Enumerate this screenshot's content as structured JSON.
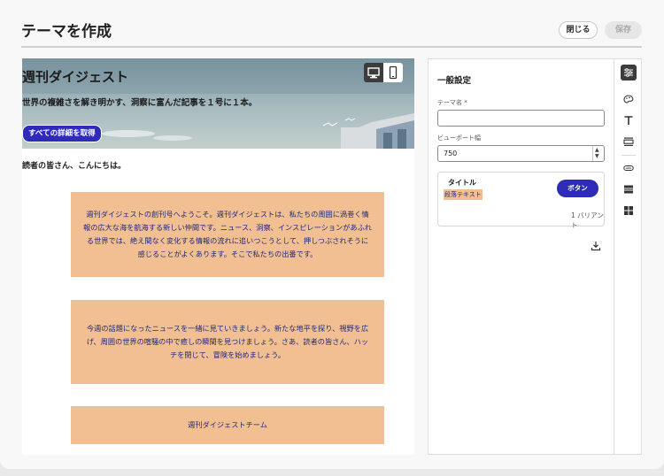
{
  "header": {
    "title": "テーマを作成",
    "close_label": "閉じる",
    "save_label": "保存"
  },
  "preview": {
    "device_icons": [
      "desktop-icon",
      "mobile-icon"
    ],
    "hero": {
      "title": "週刊ダイジェスト",
      "subtitle": "世界の複雑さを解き明かす、洞察に富んだ記事を１号に１本。",
      "button_label": "すべての詳細を取得"
    },
    "greeting": "読者の皆さん、こんにちは。",
    "blocks": [
      {
        "text": "週刊ダイジェストの創刊号へようこそ。週刊ダイジェストは、私たちの周囲に渦巻く情報の広大な海を航海する新しい仲間です。ニュース、洞察、インスピレーションがあふれる世界では、絶え間なく変化する情報の流れに追いつこうとして、押しつぶされそうに感じることがよくあります。そこで私たちの出番です。"
      },
      {
        "text": "今週の話題になったニュースを一緒に見ていきましょう。新たな地平を探り、視野を広げ、周囲の世界の喧騒の中で癒しの瞬間を見つけましょう。さあ、読者の皆さん、ハッチを閉じて、冒険を始めましょう。"
      },
      {
        "text": "週刊ダイジェストチーム"
      }
    ]
  },
  "settings": {
    "section_title": "一般設定",
    "theme_name_label": "テーマ名 *",
    "theme_name_value": "",
    "viewport_label": "ビューポート幅",
    "viewport_value": "750",
    "variant": {
      "title": "タイトル",
      "paragraph": "段落テキスト",
      "button": "ボタン",
      "count": "1 バリアント"
    }
  },
  "rail_icons": [
    "sliders-icon",
    "palette-icon",
    "text-icon",
    "image-block-icon",
    "button-icon",
    "divider-icon",
    "grid-icon"
  ],
  "colors": {
    "accent": "#2d2bb8",
    "block_bg": "#f2bf92",
    "block_text": "#1f2a7a",
    "rail_active": "#3c3c3c"
  }
}
